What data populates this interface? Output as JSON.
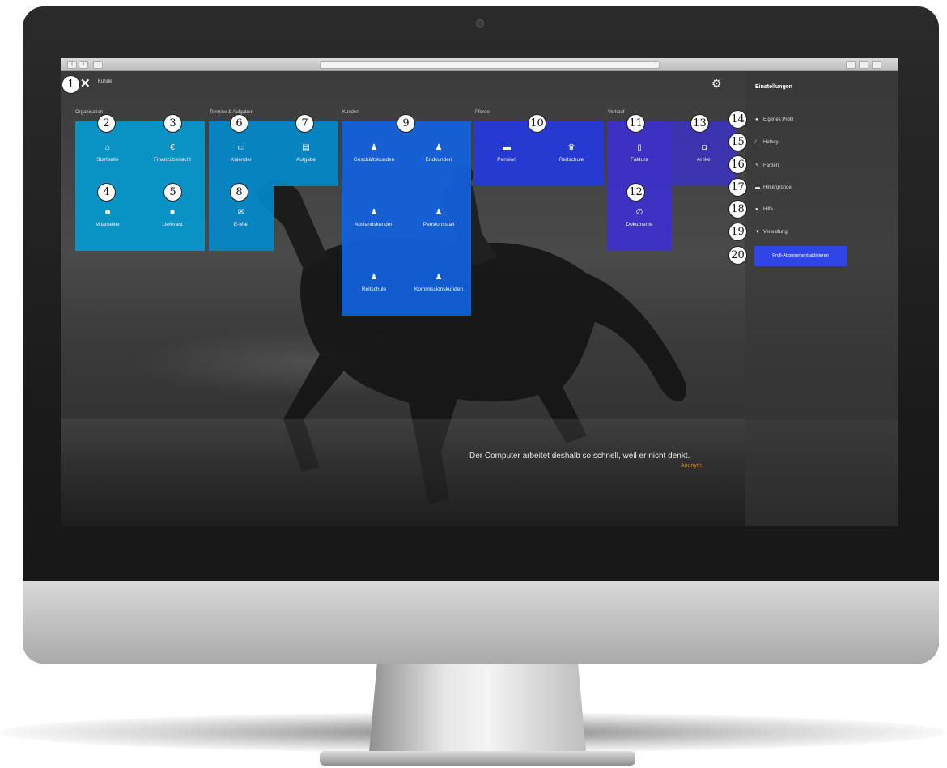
{
  "topbar": {
    "close_icon": "close-icon",
    "user": "Kunde"
  },
  "groups": {
    "org": "Organisation",
    "termine": "Termine & Aufgaben",
    "kunden": "Kunden",
    "pferde": "Pferde",
    "verkauf": "Verkauf"
  },
  "tiles": {
    "startseite": "Startseite",
    "finanzen": "Finanzübersicht",
    "mitarbeiter": "Mitarbeiter",
    "lieferant": "Lieferant",
    "kalender": "Kalender",
    "aufgabe": "Aufgabe",
    "email": "E-Mail",
    "geschaeftskunden": "Geschäftskunden",
    "endkunden": "Endkunden",
    "auslandskunden": "Auslandskunden",
    "pensionsstall": "Pensionsstall",
    "reitschule_kunden": "Reitschule",
    "kommissionskunden": "Kommissionskunden",
    "pension": "Pension",
    "reitschule": "Reitschule",
    "faktura": "Faktura",
    "dokumente": "Dokumente",
    "artikel": "Artikel"
  },
  "settings": {
    "title": "Einstellungen",
    "items": [
      "Eigenes Profil",
      "Hotkey",
      "Farben",
      "Hintergründe",
      "Hilfe",
      "Verwaltung"
    ],
    "button": "Profi-Abonnement aktivieren"
  },
  "quote": {
    "text": "Der Computer arbeitet deshalb so schnell, weil er nicht denkt.",
    "author": "Anonym"
  },
  "badges": [
    "1",
    "2",
    "3",
    "4",
    "5",
    "6",
    "7",
    "8",
    "9",
    "10",
    "11",
    "12",
    "13",
    "14",
    "15",
    "16",
    "17",
    "18",
    "19",
    "20"
  ],
  "icons": {
    "home": "home-icon",
    "euro": "euro-icon",
    "users": "users-icon",
    "truck": "truck-icon",
    "calendar": "calendar-icon",
    "task": "task-icon",
    "mail": "mail-icon",
    "person": "person-icon",
    "bed": "bed-icon",
    "trophy": "trophy-icon",
    "document": "document-icon",
    "paperclip": "paperclip-icon",
    "gift": "gift-icon",
    "gear": "gear-icon"
  }
}
